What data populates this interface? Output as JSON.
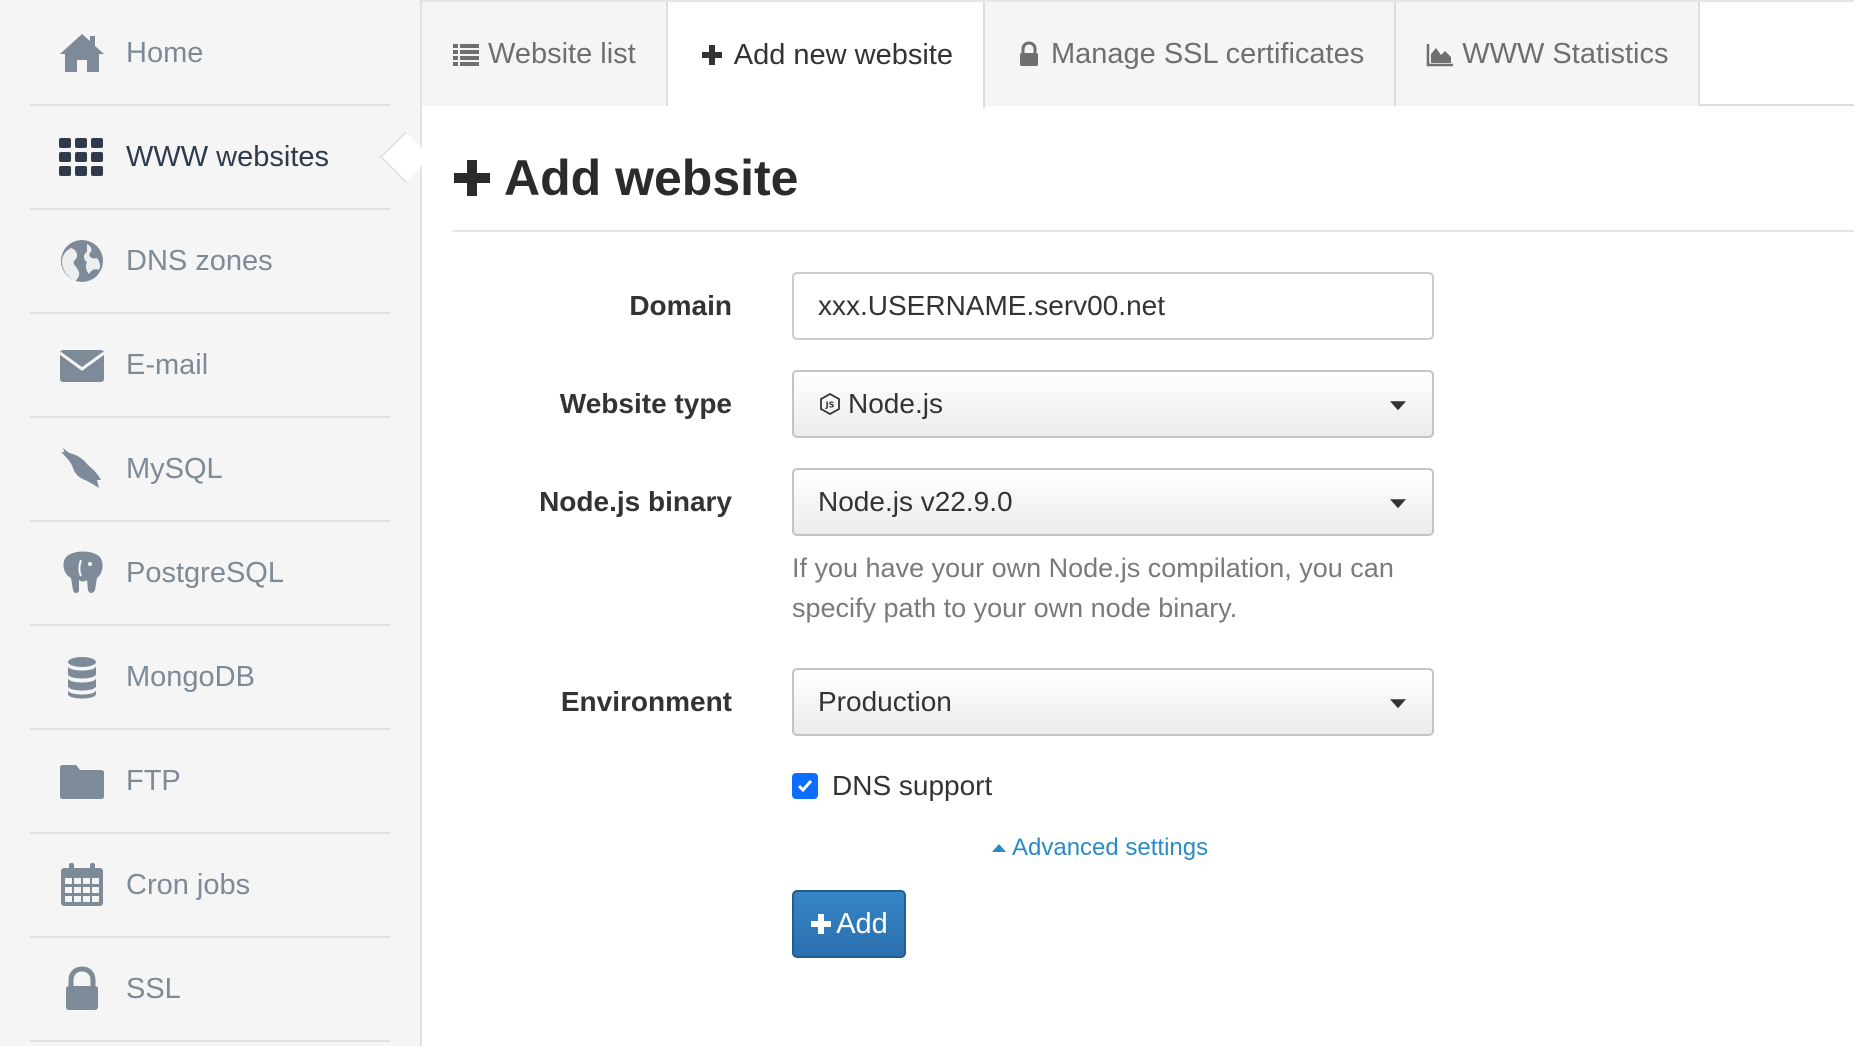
{
  "sidebar": {
    "items": [
      {
        "label": "Home",
        "icon": "home-icon"
      },
      {
        "label": "WWW websites",
        "icon": "grid-icon",
        "active": true
      },
      {
        "label": "DNS zones",
        "icon": "globe-icon"
      },
      {
        "label": "E-mail",
        "icon": "envelope-icon"
      },
      {
        "label": "MySQL",
        "icon": "dolphin-icon"
      },
      {
        "label": "PostgreSQL",
        "icon": "elephant-icon"
      },
      {
        "label": "MongoDB",
        "icon": "database-icon"
      },
      {
        "label": "FTP",
        "icon": "folder-icon"
      },
      {
        "label": "Cron jobs",
        "icon": "calendar-icon"
      },
      {
        "label": "SSL",
        "icon": "lock-icon"
      }
    ]
  },
  "tabs": [
    {
      "label": "Website list",
      "icon": "list-icon"
    },
    {
      "label": "Add new website",
      "icon": "plus-icon",
      "active": true
    },
    {
      "label": "Manage SSL certificates",
      "icon": "lock-icon"
    },
    {
      "label": "WWW Statistics",
      "icon": "area-chart-icon"
    }
  ],
  "page": {
    "title": "Add website"
  },
  "form": {
    "domain": {
      "label": "Domain",
      "value": "xxx.USERNAME.serv00.net"
    },
    "website_type": {
      "label": "Website type",
      "value": "Node.js",
      "icon": "nodejs-icon"
    },
    "node_binary": {
      "label": "Node.js binary",
      "value": "Node.js v22.9.0",
      "help": "If you have your own Node.js compilation, you can specify path to your own node binary."
    },
    "environment": {
      "label": "Environment",
      "value": "Production"
    },
    "dns_support": {
      "label": "DNS support",
      "checked": true
    },
    "advanced_settings": "Advanced settings",
    "submit_label": "Add"
  },
  "colors": {
    "sidebar_bg": "#f5f5f5",
    "sidebar_icon": "#7d8a98",
    "link": "#2a8bc5",
    "primary_button": "#2a6fae",
    "checkbox": "#0d6efd"
  }
}
